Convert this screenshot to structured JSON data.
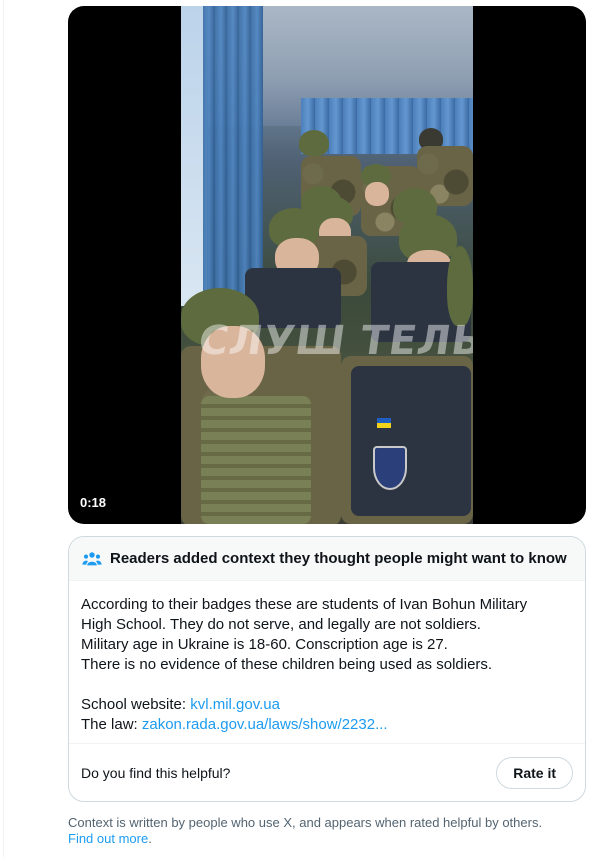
{
  "video": {
    "timestamp": "0:18",
    "watermark_text": "СЛУШ ТЕЛЬ"
  },
  "note": {
    "header_icon": "people-icon",
    "header_title": "Readers added context they thought people might want to know",
    "body_lines": [
      "According to their badges these are students of Ivan Bohun Military",
      "High School. They do not serve, and legally are not soldiers.",
      "Military age in Ukraine is 18-60. Conscription age is 27.",
      "There is no evidence of these children being used as soldiers."
    ],
    "school_label": "School website: ",
    "school_link": "kvl.mil.gov.ua",
    "law_label": "The law: ",
    "law_link": "zakon.rada.gov.ua/laws/show/2232...",
    "helpful_question": "Do you find this helpful?",
    "rate_button": "Rate it"
  },
  "disclaimer": {
    "text": "Context is written by people who use X, and appears when rated helpful by others.",
    "link": "Find out more",
    "suffix": "."
  },
  "colors": {
    "accent": "#1d9bf0",
    "text_primary": "#0f1419",
    "text_secondary": "#536471",
    "border": "#cfd9de"
  }
}
